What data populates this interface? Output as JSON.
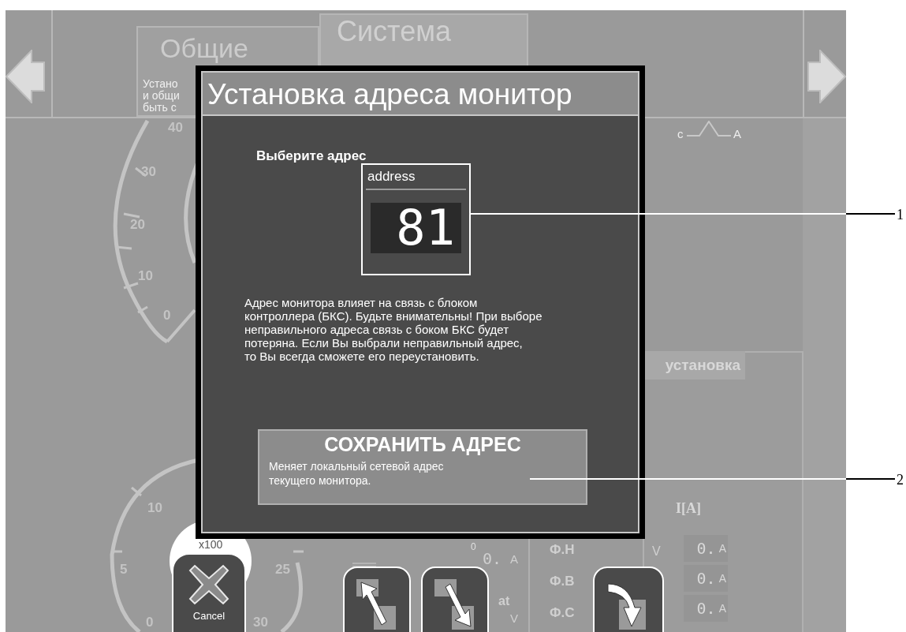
{
  "tabs": [
    {
      "label": "Общие",
      "selected": false,
      "description_lines": [
        "Устано",
        "и общи",
        "быть с"
      ]
    },
    {
      "label": "Система",
      "selected": true
    }
  ],
  "gauges": {
    "top_ticks": [
      "40",
      "30",
      "20",
      "10",
      "0"
    ],
    "bottom_left_ticks": [
      "10",
      "5",
      "0"
    ],
    "bottom_right_ticks": [
      "25",
      "30"
    ],
    "multiplier": "x100"
  },
  "wave_labels": [
    "c",
    "A"
  ],
  "panel_header": "установка",
  "left_readout": {
    "value": "0.",
    "unit": "A",
    "label": "at",
    "unit_2": "V",
    "scale_mark": "0"
  },
  "phases": [
    {
      "label": "Ф.Н"
    },
    {
      "label": "Ф.В"
    },
    {
      "label": "Ф.С"
    }
  ],
  "voltage_unit": "V",
  "current_header": "I[A]",
  "currents": [
    {
      "value": "0.",
      "unit": "A"
    },
    {
      "value": "0.",
      "unit": "A"
    },
    {
      "value": "0.",
      "unit": "A"
    }
  ],
  "cancel_label": "Cancel",
  "dialog": {
    "title": "Установка адреса монитор",
    "prompt": "Выберите адрес",
    "address_label": "address",
    "address_value": "81",
    "warning_lines": [
      "Адрес монитора влияет на связь с блоком",
      "контроллера (БКС). Будьте внимательны! При выборе",
      "неправильного адреса связь с боком БКС будет",
      "потеряна. Если Вы выбрали неправильный адрес,",
      "то Вы всегда сможете его переустановить."
    ],
    "save_button": {
      "title": "СОХРАНИТЬ АДРЕС",
      "description_lines": [
        "Меняет локальный сетевой адрес",
        "текущего монитора."
      ]
    }
  },
  "callouts": [
    "1",
    "2"
  ]
}
